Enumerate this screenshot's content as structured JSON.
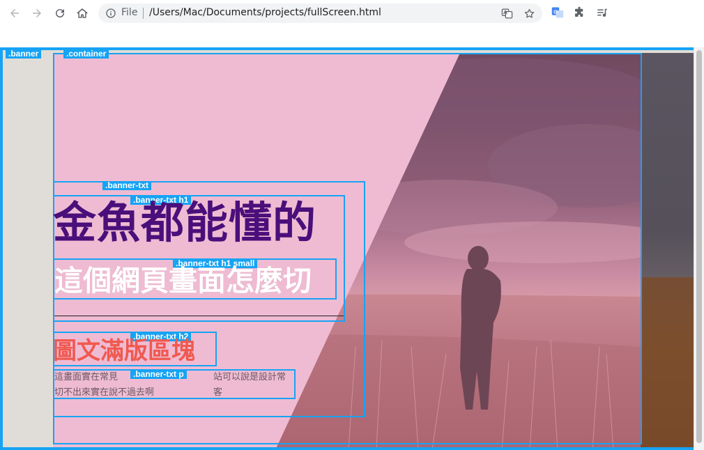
{
  "browser": {
    "scheme_label": "File",
    "url": "/Users/Mac/Documents/projects/fullScreen.html"
  },
  "overlay_labels": {
    "banner": ".banner",
    "container": ".container",
    "banner_txt": ".banner-txt",
    "banner_txt_h1": ".banner-txt h1",
    "banner_txt_h1_small": ".banner-txt h1 small",
    "banner_txt_h2": ".banner-txt h2",
    "banner_txt_p": ".banner-txt p"
  },
  "banner": {
    "h1": "金魚都能懂的",
    "h1_small": "這個網頁畫面怎麼切",
    "h2": "圖文滿版區塊",
    "p_line1": "這畫面實在常見",
    "p_line1_end": "站可以說是設計常客",
    "p_line2": "切不出來實在說不過去啊"
  },
  "colors": {
    "overlay_blue": "#16a3f4",
    "h1": "#4a0f7a",
    "h2": "#f0594f",
    "pink_panel": "#efbbd2"
  }
}
